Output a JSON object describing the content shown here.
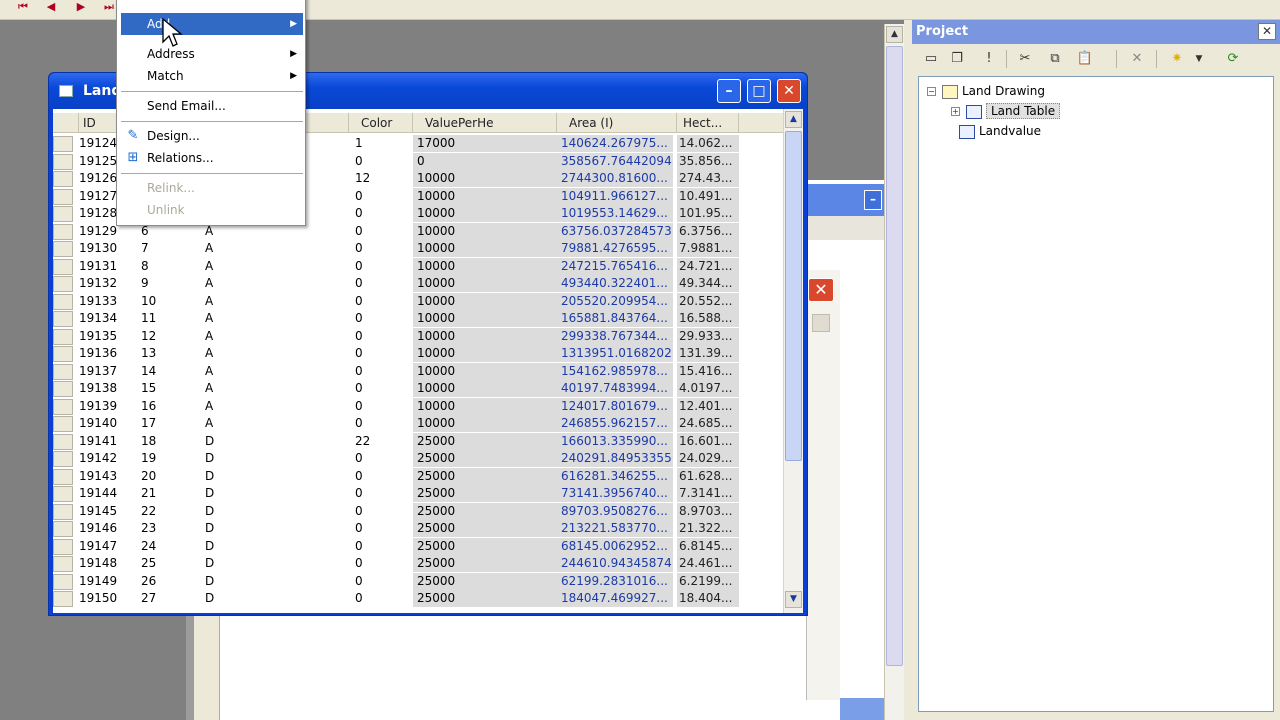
{
  "colors": {
    "titlebar": "#0a48d8",
    "selection": "#316ac5",
    "project_title": "#7a96df",
    "area_text": "#1c3aa8"
  },
  "nav_icons": [
    "first-record-icon",
    "previous-record-icon",
    "next-record-icon",
    "last-record-icon"
  ],
  "context_menu": {
    "items": [
      {
        "label": "Add",
        "submenu": true,
        "highlighted": true
      },
      {
        "label": "Address",
        "submenu": true
      },
      {
        "label": "Match",
        "submenu": true
      },
      {
        "label": "Send Email..."
      },
      {
        "label": "Design...",
        "icon": "design-icon"
      },
      {
        "label": "Relations...",
        "icon": "relations-icon"
      },
      {
        "label": "Relink...",
        "disabled": true
      },
      {
        "label": "Unlink",
        "disabled": true
      }
    ]
  },
  "table_window": {
    "title": "Land",
    "columns": [
      "ID",
      "Color",
      "ValuePerHe",
      "Area (I)",
      "Hect..."
    ],
    "rows": [
      [
        "19124",
        "",
        "",
        "1",
        "17000",
        "140624.267975...",
        "14.062..."
      ],
      [
        "19125",
        "",
        "",
        "0",
        "0",
        "358567.76442094",
        "35.856..."
      ],
      [
        "19126",
        "",
        "",
        "12",
        "10000",
        "2744300.81600...",
        "274.43..."
      ],
      [
        "19127",
        "",
        "",
        "0",
        "10000",
        "104911.966127...",
        "10.491..."
      ],
      [
        "19128",
        "",
        "",
        "0",
        "10000",
        "1019553.14629...",
        "101.95..."
      ],
      [
        "19129",
        "6",
        "A",
        "0",
        "10000",
        "63756.037284573",
        "6.3756..."
      ],
      [
        "19130",
        "7",
        "A",
        "0",
        "10000",
        "79881.4276595...",
        "7.9881..."
      ],
      [
        "19131",
        "8",
        "A",
        "0",
        "10000",
        "247215.765416...",
        "24.721..."
      ],
      [
        "19132",
        "9",
        "A",
        "0",
        "10000",
        "493440.322401...",
        "49.344..."
      ],
      [
        "19133",
        "10",
        "A",
        "0",
        "10000",
        "205520.209954...",
        "20.552..."
      ],
      [
        "19134",
        "11",
        "A",
        "0",
        "10000",
        "165881.843764...",
        "16.588..."
      ],
      [
        "19135",
        "12",
        "A",
        "0",
        "10000",
        "299338.767344...",
        "29.933..."
      ],
      [
        "19136",
        "13",
        "A",
        "0",
        "10000",
        "1313951.0168202",
        "131.39..."
      ],
      [
        "19137",
        "14",
        "A",
        "0",
        "10000",
        "154162.985978...",
        "15.416..."
      ],
      [
        "19138",
        "15",
        "A",
        "0",
        "10000",
        "40197.7483994...",
        "4.0197..."
      ],
      [
        "19139",
        "16",
        "A",
        "0",
        "10000",
        "124017.801679...",
        "12.401..."
      ],
      [
        "19140",
        "17",
        "A",
        "0",
        "10000",
        "246855.962157...",
        "24.685..."
      ],
      [
        "19141",
        "18",
        "D",
        "22",
        "25000",
        "166013.335990...",
        "16.601..."
      ],
      [
        "19142",
        "19",
        "D",
        "0",
        "25000",
        "240291.84953355",
        "24.029..."
      ],
      [
        "19143",
        "20",
        "D",
        "0",
        "25000",
        "616281.346255...",
        "61.628..."
      ],
      [
        "19144",
        "21",
        "D",
        "0",
        "25000",
        "73141.3956740...",
        "7.3141..."
      ],
      [
        "19145",
        "22",
        "D",
        "0",
        "25000",
        "89703.9508276...",
        "8.9703..."
      ],
      [
        "19146",
        "23",
        "D",
        "0",
        "25000",
        "213221.583770...",
        "21.322..."
      ],
      [
        "19147",
        "24",
        "D",
        "0",
        "25000",
        "68145.0062952...",
        "6.8145..."
      ],
      [
        "19148",
        "25",
        "D",
        "0",
        "25000",
        "244610.94345874",
        "24.461..."
      ],
      [
        "19149",
        "26",
        "D",
        "0",
        "25000",
        "62199.2831016...",
        "6.2199..."
      ],
      [
        "19150",
        "27",
        "D",
        "0",
        "25000",
        "184047.469927...",
        "18.404..."
      ]
    ]
  },
  "project_panel": {
    "title": "Project",
    "toolbar_icons": [
      "new-window-icon",
      "restore-window-icon",
      "pin-icon",
      "cut-icon",
      "copy-icon",
      "paste-icon",
      "delete-icon",
      "add-item-icon",
      "refresh-icon"
    ],
    "tree": [
      {
        "label": "Land Drawing",
        "icon": "drawing-icon"
      },
      {
        "label": "Land Table",
        "icon": "table-icon",
        "selected": true,
        "expander": "+"
      },
      {
        "label": "Landvalue",
        "icon": "table-icon"
      }
    ]
  }
}
